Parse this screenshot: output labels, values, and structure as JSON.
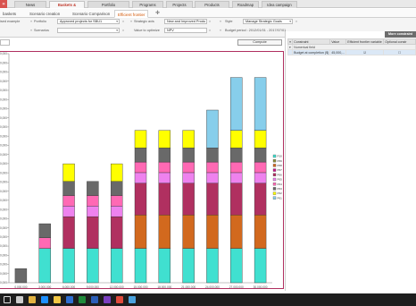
{
  "top_tabs": [
    {
      "label": "News"
    },
    {
      "label": "Baskets & investments",
      "active": true
    },
    {
      "label": "Portfolio"
    },
    {
      "label": "Programs"
    },
    {
      "label": "Projects"
    },
    {
      "label": "Products"
    },
    {
      "label": "Roadmap"
    },
    {
      "label": "Idea campaign"
    }
  ],
  "sub_tabs": [
    {
      "label": "baskets"
    },
    {
      "label": "Scenario creation"
    },
    {
      "label": "Scenario Comparison"
    },
    {
      "label": "Efficient frontier",
      "active": true
    }
  ],
  "filters": {
    "left_text_1": "ised example",
    "portfolio_label": "Portfolio",
    "portfolio_value": "Approved projects for SBU1",
    "scenarios_label": "Scenarios",
    "strategic_axis_label": "Strategic axis",
    "strategic_axis_value": "New and Improved Produ",
    "value_to_optimize_label": "Value to optimize",
    "value_to_optimize_value": "NPV",
    "style_label": "Style",
    "style_value": "Manage Strategic Goals",
    "budget_period": "Budget period : 2012/01/01 - 2017/07/01"
  },
  "compute_label": "Compute",
  "more_constraints_label": "More constraint",
  "constraints_table": {
    "headers": [
      "Constraint",
      "Value",
      "Efficient frontier variable",
      "Optional constr"
    ],
    "group_label": "Numerical field",
    "rows": [
      {
        "constraint": "Budget at completion ($)",
        "value": "45,000,...",
        "efficient": true,
        "optional": false
      }
    ]
  },
  "colors": {
    "frame": "#b03060",
    "active_tab": "#c0392b",
    "subtab_active": "#d35400"
  },
  "chart_data": {
    "type": "bar",
    "stacked": true,
    "categories": [
      "0,000,000",
      "3,000,000",
      "6,000,000",
      "9,000,000",
      "12,000,000",
      "15,000,000",
      "18,000,000",
      "21,000,000",
      "24,000,000",
      "27,000,000",
      "30,000,000"
    ],
    "y_tick_labels": [
      "0,000",
      "0,000",
      "0,000",
      "0,000",
      "0,000",
      "0,000",
      "0,000",
      "0,000",
      "0,000",
      "0,000",
      "0,000",
      "0,000",
      "0,000",
      "0,000",
      "0,000",
      "0,000",
      "0,000",
      "0,000",
      "0,000",
      "0,000",
      "0,000",
      "0,000",
      "0,000",
      "0,000",
      "0,000",
      "0,000"
    ],
    "legend_position": "right",
    "ylim": [
      0,
      26
    ],
    "series": [
      {
        "name": "P10",
        "color": "#40e0d0",
        "values": [
          0,
          3.9,
          3.9,
          3.9,
          3.9,
          3.9,
          3.9,
          3.9,
          3.9,
          3.9,
          3.9
        ]
      },
      {
        "name": "P09",
        "color": "#8b8b3a",
        "values": [
          0,
          0,
          0,
          0,
          0,
          0,
          0,
          0,
          0,
          0,
          0
        ]
      },
      {
        "name": "P08",
        "color": "#d2691e",
        "values": [
          0,
          0,
          0,
          0,
          0,
          3.8,
          3.8,
          3.8,
          3.8,
          3.8,
          3.8
        ]
      },
      {
        "name": "P07",
        "color": "#c71585",
        "values": [
          0,
          0,
          0,
          0,
          0,
          0,
          0,
          0,
          0,
          0,
          0
        ]
      },
      {
        "name": "P06",
        "color": "#b03060",
        "values": [
          0,
          0,
          3.6,
          3.6,
          3.6,
          3.6,
          3.6,
          3.6,
          3.6,
          3.6,
          3.6
        ]
      },
      {
        "name": "P05",
        "color": "#ee82ee",
        "values": [
          0,
          0,
          1.2,
          1.2,
          1.2,
          1.2,
          1.2,
          1.2,
          1.2,
          1.2,
          1.2
        ]
      },
      {
        "name": "P04",
        "color": "#ff69b4",
        "values": [
          0,
          1.2,
          1.2,
          1.2,
          1.2,
          1.2,
          1.2,
          1.2,
          1.2,
          1.2,
          1.2
        ]
      },
      {
        "name": "P03",
        "color": "#696969",
        "values": [
          1.6,
          1.6,
          1.6,
          1.6,
          1.6,
          1.6,
          1.6,
          1.6,
          1.6,
          1.6,
          1.6
        ]
      },
      {
        "name": "P02",
        "color": "#ffff00",
        "values": [
          0,
          0,
          2.0,
          0,
          2.0,
          2.0,
          2.0,
          2.0,
          0,
          2.0,
          2.0
        ]
      },
      {
        "name": "P01",
        "color": "#87ceeb",
        "values": [
          0,
          0,
          0,
          0,
          0,
          0,
          0,
          0,
          4.3,
          6.0,
          6.0
        ]
      }
    ]
  },
  "taskbar_icons": [
    "windows-start-icon",
    "search-icon",
    "folder-icon",
    "ie-icon",
    "explorer-icon",
    "outlook-icon",
    "excel-icon",
    "word-icon",
    "media-icon",
    "chrome-icon",
    "app-icon"
  ]
}
